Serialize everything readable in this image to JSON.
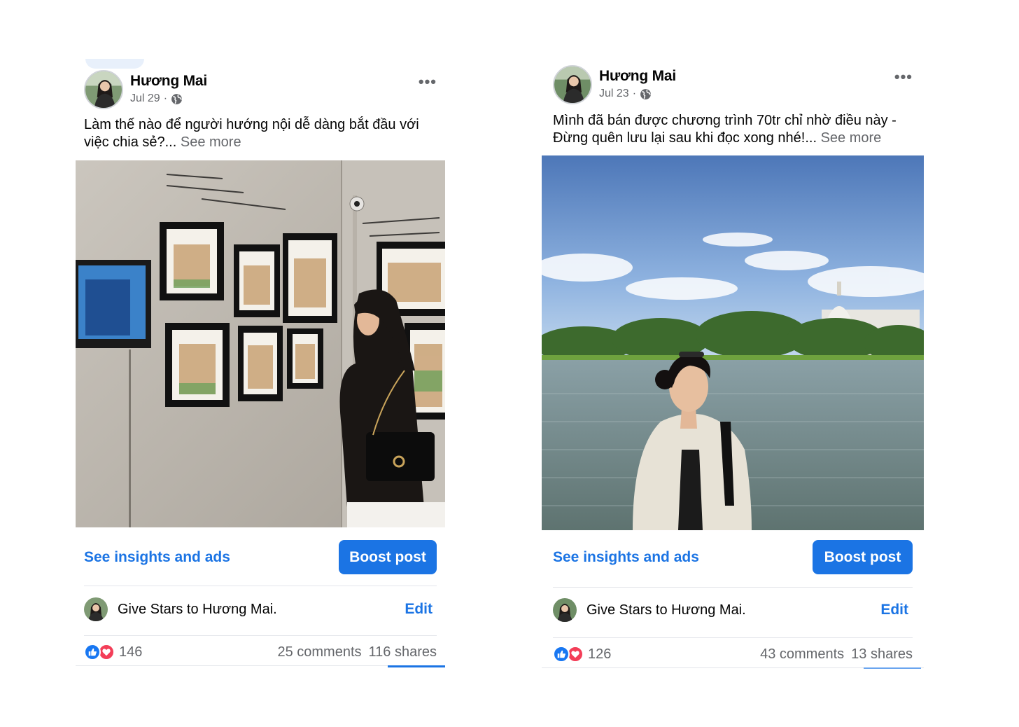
{
  "posts": [
    {
      "author": "Hương Mai",
      "date": "Jul 29",
      "privacy_icon": "globe-icon",
      "more_icon": "ellipsis-icon",
      "caption": "Làm thế nào để người hướng nội dễ dàng bắt đầu với việc chia sẻ?...",
      "see_more": "See more",
      "insights_label": "See insights and ads",
      "boost_label": "Boost post",
      "stars_text": "Give Stars to Hương Mai.",
      "edit_label": "Edit",
      "reaction_count": "146",
      "comments": "25 comments",
      "shares": "116 shares"
    },
    {
      "author": "Hương Mai",
      "date": "Jul 23",
      "privacy_icon": "globe-icon",
      "more_icon": "ellipsis-icon",
      "caption": "Mình đã bán được chương trình 70tr chỉ nhờ điều này - Đừng quên lưu lại sau khi đọc xong nhé!...",
      "see_more": "See more",
      "insights_label": "See insights and ads",
      "boost_label": "Boost post",
      "stars_text": "Give Stars to Hương Mai.",
      "edit_label": "Edit",
      "reaction_count": "126",
      "comments": "43 comments",
      "shares": "13 shares"
    }
  ],
  "colors": {
    "accent": "#1b74e4",
    "like": "#1877f2",
    "love": "#f33e58",
    "muted_text": "#65676b",
    "divider": "#e4e6eb"
  }
}
